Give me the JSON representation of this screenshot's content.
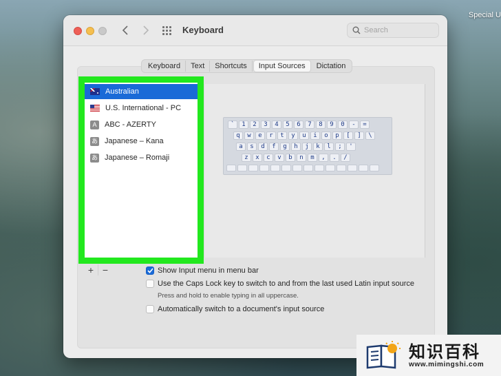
{
  "desktop": {
    "label": "Special U"
  },
  "window": {
    "title": "Keyboard",
    "search": {
      "placeholder": "Search",
      "value": ""
    },
    "tabs": [
      {
        "label": "Keyboard",
        "active": false
      },
      {
        "label": "Text",
        "active": false
      },
      {
        "label": "Shortcuts",
        "active": false
      },
      {
        "label": "Input Sources",
        "active": true
      },
      {
        "label": "Dictation",
        "active": false
      }
    ]
  },
  "sources": [
    {
      "label": "Australian",
      "icon": "australia-flag-icon",
      "selected": true
    },
    {
      "label": "U.S. International - PC",
      "icon": "us-flag-icon",
      "selected": false
    },
    {
      "label": "ABC - AZERTY",
      "icon": "letter-a-icon",
      "glyph": "A",
      "selected": false
    },
    {
      "label": "Japanese – Kana",
      "icon": "japanese-kana-icon",
      "glyph": "あ",
      "selected": false
    },
    {
      "label": "Japanese – Romaji",
      "icon": "japanese-kana-icon",
      "glyph": "あ",
      "selected": false
    }
  ],
  "keyboard_rows": [
    [
      "`",
      "1",
      "2",
      "3",
      "4",
      "5",
      "6",
      "7",
      "8",
      "9",
      "0",
      "-",
      "="
    ],
    [
      "q",
      "w",
      "e",
      "r",
      "t",
      "y",
      "u",
      "i",
      "o",
      "p",
      "[",
      "]",
      "\\"
    ],
    [
      "a",
      "s",
      "d",
      "f",
      "g",
      "h",
      "j",
      "k",
      "l",
      ";",
      "'"
    ],
    [
      "z",
      "x",
      "c",
      "v",
      "b",
      "n",
      "m",
      ",",
      ".",
      "/"
    ]
  ],
  "buttons": {
    "add": "+",
    "remove": "−"
  },
  "options": {
    "show_menu": {
      "label": "Show Input menu in menu bar",
      "checked": true
    },
    "caps_lock": {
      "label": "Use the Caps Lock key to switch to and from the last used Latin input source",
      "checked": false,
      "hint": "Press and hold to enable typing in all uppercase."
    },
    "auto_switch": {
      "label": "Automatically switch to a document's input source",
      "checked": false
    }
  },
  "watermark": {
    "title": "知识百科",
    "url": "www.mimingshi.com"
  },
  "colors": {
    "highlight": "#22e81e",
    "selection": "#1a6ad7"
  }
}
